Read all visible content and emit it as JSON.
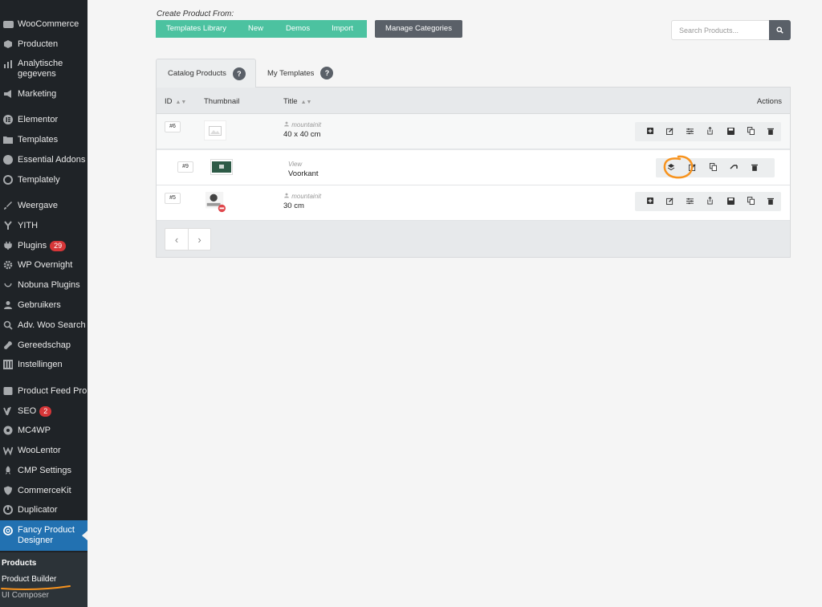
{
  "sidebar": {
    "items": [
      {
        "label": "WooCommerce",
        "icon": "woo-icon"
      },
      {
        "label": "Producten",
        "icon": "box-icon"
      },
      {
        "label": "Analytische gegevens",
        "icon": "bar-chart-icon"
      },
      {
        "label": "Marketing",
        "icon": "megaphone-icon"
      },
      {
        "label": "Elementor",
        "icon": "elementor-icon"
      },
      {
        "label": "Templates",
        "icon": "folder-icon"
      },
      {
        "label": "Essential Addons",
        "icon": "ea-icon"
      },
      {
        "label": "Templately",
        "icon": "templately-icon"
      },
      {
        "label": "Weergave",
        "icon": "brush-icon"
      },
      {
        "label": "YITH",
        "icon": "yith-icon"
      },
      {
        "label": "Plugins",
        "icon": "plug-icon",
        "badge": "29"
      },
      {
        "label": "WP Overnight",
        "icon": "gear-icon"
      },
      {
        "label": "Nobuna Plugins",
        "icon": "smile-icon"
      },
      {
        "label": "Gebruikers",
        "icon": "user-icon"
      },
      {
        "label": "Adv. Woo Search",
        "icon": "search-icon"
      },
      {
        "label": "Gereedschap",
        "icon": "wrench-icon"
      },
      {
        "label": "Instellingen",
        "icon": "sliders-icon"
      },
      {
        "label": "Product Feed Pro",
        "icon": "feed-icon"
      },
      {
        "label": "SEO",
        "icon": "yoast-icon",
        "badge": "2"
      },
      {
        "label": "MC4WP",
        "icon": "mailchimp-icon"
      },
      {
        "label": "WooLentor",
        "icon": "woolentor-icon"
      },
      {
        "label": "CMP Settings",
        "icon": "rocket-icon"
      },
      {
        "label": "CommerceKit",
        "icon": "shield-icon"
      },
      {
        "label": "Duplicator",
        "icon": "duplicator-icon"
      },
      {
        "label": "Fancy Product Designer",
        "icon": "fpd-icon"
      }
    ],
    "submenu": {
      "heading": "Products",
      "items": [
        "Product Builder",
        "UI Composer"
      ]
    }
  },
  "main": {
    "create_label": "Create Product From:",
    "create_buttons": [
      "Templates Library",
      "New",
      "Demos",
      "Import"
    ],
    "manage_categories": "Manage Categories",
    "search_placeholder": "Search Products...",
    "tabs": [
      {
        "label": "Catalog Products",
        "help": "?"
      },
      {
        "label": "My Templates",
        "help": "?"
      }
    ],
    "table": {
      "headers": {
        "id": "ID",
        "thumbnail": "Thumbnail",
        "title": "Title",
        "actions": "Actions"
      },
      "rows": [
        {
          "id": "#6",
          "author": "mountainit",
          "title": "40 x 40 cm"
        },
        {
          "id": "#9",
          "view": "View",
          "title": "Voorkant"
        },
        {
          "id": "#5",
          "author": "mountainit",
          "title": "30 cm"
        }
      ]
    }
  },
  "colors": {
    "sidebar_bg": "#1f2327",
    "accent_green": "#4cc2a0",
    "dark_button": "#5a6068",
    "wp_blue": "#2271b1",
    "annotation_orange": "#f7931e",
    "badge_red": "#d63638"
  }
}
